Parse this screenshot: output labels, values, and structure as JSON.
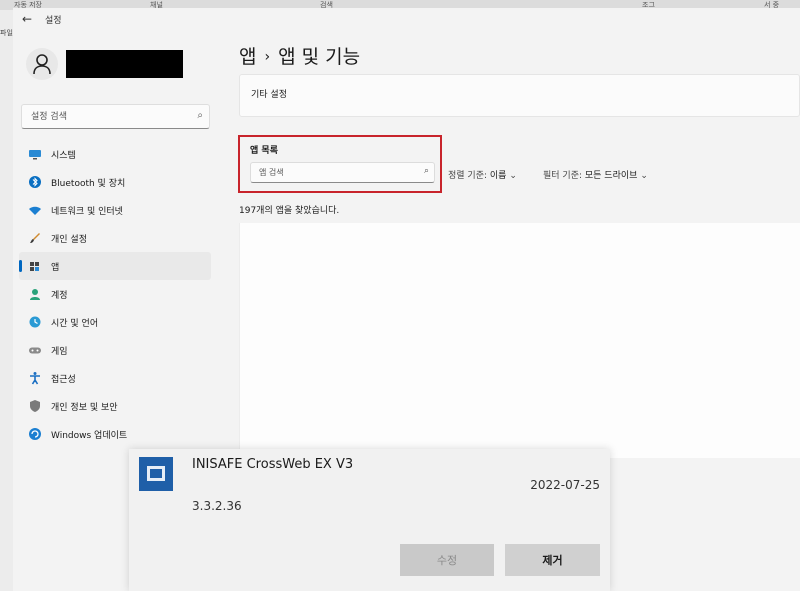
{
  "browser": {
    "fragments": [
      "자동 저장",
      "채널",
      "검색",
      "조그",
      "서 중"
    ],
    "left_edge_text": "파일"
  },
  "window": {
    "title": "설정"
  },
  "sidebar": {
    "search_placeholder": "설정 검색",
    "items": [
      {
        "label": "시스템",
        "icon": "monitor-icon",
        "active": false
      },
      {
        "label": "Bluetooth 및 장치",
        "icon": "bluetooth-icon",
        "active": false
      },
      {
        "label": "네트워크 및 인터넷",
        "icon": "wifi-icon",
        "active": false
      },
      {
        "label": "개인 설정",
        "icon": "brush-icon",
        "active": false
      },
      {
        "label": "앱",
        "icon": "apps-icon",
        "active": true
      },
      {
        "label": "계정",
        "icon": "person-icon",
        "active": false
      },
      {
        "label": "시간 및 언어",
        "icon": "globe-clock-icon",
        "active": false
      },
      {
        "label": "게임",
        "icon": "gamepad-icon",
        "active": false
      },
      {
        "label": "접근성",
        "icon": "accessibility-icon",
        "active": false
      },
      {
        "label": "개인 정보 및 보안",
        "icon": "shield-icon",
        "active": false
      },
      {
        "label": "Windows 업데이트",
        "icon": "update-icon",
        "active": false
      }
    ]
  },
  "main": {
    "breadcrumb_parent": "앱",
    "breadcrumb_sep": "›",
    "breadcrumb_current": "앱 및 기능",
    "other_settings": "기타 설정",
    "app_list_heading": "앱 목록",
    "app_search_placeholder": "앱 검색",
    "sort_label": "정렬 기준:",
    "sort_value": "이름",
    "filter_label": "필터 기준:",
    "filter_value": "모든 드라이브",
    "count_text": "197개의 앱을 찾았습니다."
  },
  "dialog": {
    "app_name": "INISAFE CrossWeb EX V3",
    "date": "2022-07-25",
    "version": "3.3.2.36",
    "modify_label": "수정",
    "remove_label": "제거"
  },
  "colors": {
    "accent": "#0067c0",
    "highlight_box": "#c8242b",
    "app_icon": "#1f5fa8"
  }
}
